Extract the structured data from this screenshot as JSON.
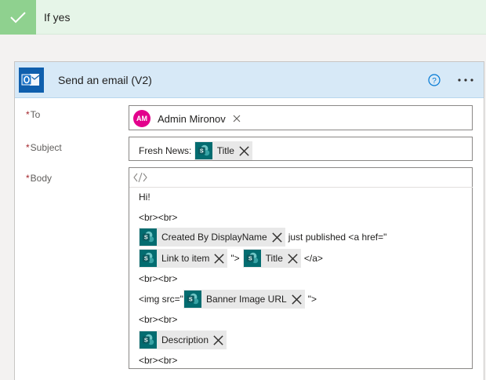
{
  "branch": {
    "title": "If yes"
  },
  "action": {
    "title": "Send an email (V2)",
    "icons": {
      "app": "outlook-icon",
      "help": "help-icon",
      "menu": "more-options-icon"
    }
  },
  "fields": {
    "to": {
      "label": "To",
      "recipient": {
        "initials": "AM",
        "name": "Admin Mironov"
      }
    },
    "subject": {
      "label": "Subject",
      "prefix": "Fresh News: ",
      "token": "Title"
    },
    "body": {
      "label": "Body",
      "toolbar_icon": "code-view-icon",
      "lines": {
        "l1": "Hi!",
        "l2": "<br><br>",
        "l3_token": "Created By DisplayName",
        "l3_text": "just published <a href=\"",
        "l4_token1": "Link to item",
        "l4_text1": "\">",
        "l4_token2": "Title",
        "l4_text2": "</a>",
        "l5": "<br><br>",
        "l6_text1": "<img src=\"",
        "l6_token": "Banner Image URL",
        "l6_text2": "\">",
        "l7": "<br><br>",
        "l8_token": "Description",
        "l9": "<br><br>"
      }
    }
  },
  "colors": {
    "accent": "#0078d4",
    "sharepoint": "#036c70",
    "branch": "#8fd18f",
    "header": "#d7e9f7",
    "avatar": "#e3008c"
  }
}
